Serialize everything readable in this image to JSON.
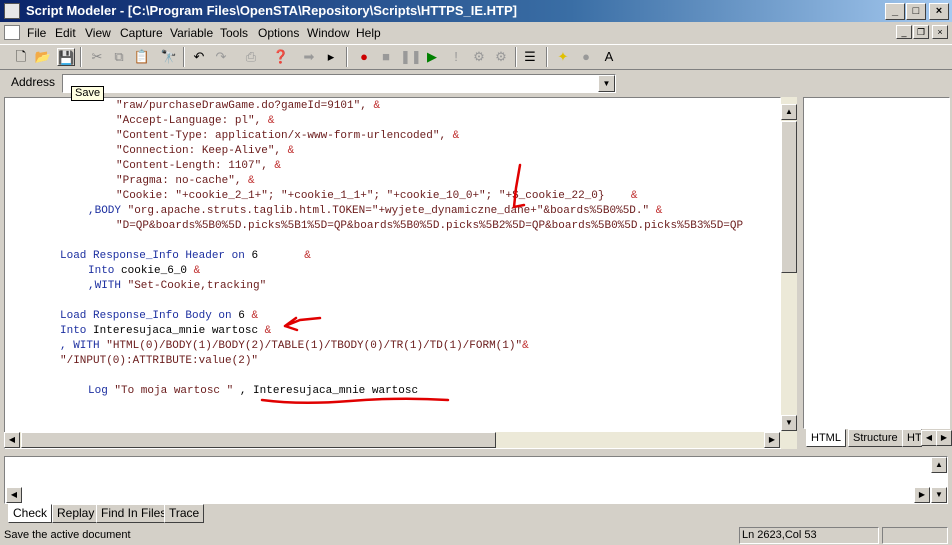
{
  "window": {
    "title": "Script Modeler - [C:\\Program Files\\OpenSTA\\Repository\\Scripts\\HTTPS_IE.HTP]",
    "controls": [
      "minimize",
      "maximize",
      "close"
    ]
  },
  "menu": [
    "File",
    "Edit",
    "View",
    "Capture",
    "Variable",
    "Tools",
    "Options",
    "Window",
    "Help"
  ],
  "address": {
    "label": "Address",
    "value": ""
  },
  "tooltip": "Save",
  "code": {
    "header_lines": [
      "\"raw/purchaseDrawGame.do?gameId=9101\",",
      "\"Accept-Language: pl\",",
      "\"Content-Type: application/x-www-form-urlencoded\",",
      "\"Connection: Keep-Alive\",",
      "\"Content-Length: 1107\",",
      "\"Pragma: no-cache\","
    ],
    "cookie_line_parts": [
      "\"Cookie: \"+cookie_2_1+\"; \"+cookie_1_1+\"; \"+cookie_10_0+\"; \"+S_cookie_22_0}"
    ],
    "body_prefix": ",BODY ",
    "body_string": "\"org.apache.struts.taglib.html.TOKEN=\"+wyjete_dynamiczne_dane+\"&boards%5B0%5D.\"",
    "body_line2": "\"D=QP&boards%5B0%5D.picks%5B1%5D=QP&boards%5B0%5D.picks%5B2%5D=QP&boards%5B0%5D.picks%5B3%5D=QP",
    "load1_kw": "Load Response_Info Header on",
    "load1_num": "6",
    "into1_kw": "Into",
    "into1_var": "cookie_6_0",
    "with1_kw": ",WITH",
    "with1_str": "\"Set-Cookie,tracking\"",
    "load2_kw": "Load Response_Info Body on",
    "load2_num": "6",
    "into2_kw": "Into",
    "into2_var": "Interesujaca_mnie wartosc",
    "with2_kw": ", WITH",
    "with2_str": "\"HTML(0)/BODY(1)/BODY(2)/TABLE(1)/TBODY(0)/TR(1)/TD(1)/FORM(1)\"",
    "with2_line2": "\"/INPUT(0):ATTRIBUTE:value(2)\"",
    "log_kw": "Log",
    "log_str": "\"To moja wartosc \"",
    "log_sep": ",",
    "log_var": "Interesujaca_mnie wartosc",
    "amp": "&"
  },
  "right_tabs": [
    "HTML",
    "Structure",
    "HT"
  ],
  "bottom_tabs": [
    "Check",
    "Replay",
    "Find In Files",
    "Trace"
  ],
  "status": {
    "message": "Save the active document",
    "position": "Ln 2623,Col 53"
  },
  "colors": {
    "string": "#6a1b1b",
    "keyword": "#1c2fa0",
    "amp": "#c03030",
    "annotation": "#e00000"
  }
}
